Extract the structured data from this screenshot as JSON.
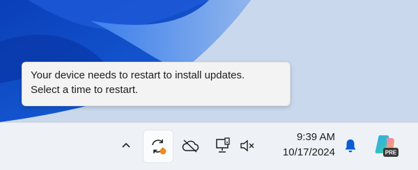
{
  "tooltip": {
    "line1": "Your device needs to restart to install updates.",
    "line2": "Select a time to restart."
  },
  "clock": {
    "time": "9:39 AM",
    "date": "10/17/2024"
  },
  "copilot": {
    "badge": "PRE"
  },
  "icons": {
    "chevron": "chevron-up-icon",
    "update": "update-pending-icon",
    "cloud": "cloud-offline-icon",
    "network": "network-icon",
    "volume": "volume-muted-icon",
    "bell": "notification-bell-icon",
    "copilot": "copilot-icon"
  },
  "colors": {
    "accent": "#0a5bd6",
    "update_dot": "#f28a1c",
    "taskbar": "#eef1f5"
  }
}
